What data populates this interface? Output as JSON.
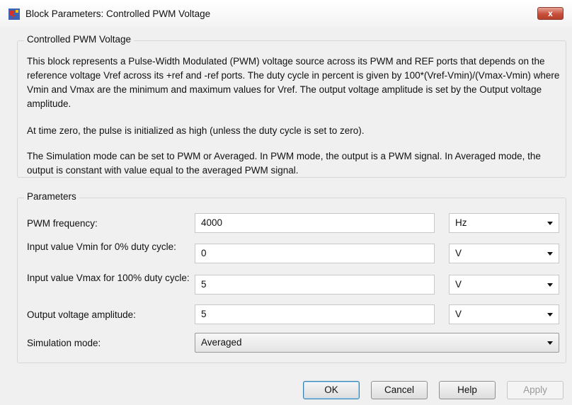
{
  "window": {
    "title": "Block Parameters: Controlled PWM Voltage",
    "close_symbol": "x"
  },
  "description_group": {
    "legend": "Controlled PWM Voltage",
    "paragraphs": [
      "This block represents a Pulse-Width Modulated (PWM) voltage source across its PWM and REF ports that depends on the reference voltage Vref across its +ref and -ref ports. The duty cycle in percent is given by 100*(Vref-Vmin)/(Vmax-Vmin) where Vmin and Vmax are the minimum and maximum values for Vref. The output voltage amplitude is set by the Output voltage amplitude.",
      "At time zero, the pulse is initialized as high (unless the duty cycle is set to zero).",
      "The Simulation mode can be set to PWM or Averaged. In PWM mode, the output is a PWM signal. In Averaged mode, the output is constant with value equal to the averaged PWM signal."
    ]
  },
  "parameters_group": {
    "legend": "Parameters",
    "pwm_frequency": {
      "label": "PWM frequency:",
      "value": "4000",
      "unit": "Hz"
    },
    "vmin": {
      "label": "Input value Vmin for 0% duty cycle:",
      "value": "0",
      "unit": "V"
    },
    "vmax": {
      "label": "Input value Vmax for 100% duty cycle:",
      "value": "5",
      "unit": "V"
    },
    "amplitude": {
      "label": "Output voltage amplitude:",
      "value": "5",
      "unit": "V"
    },
    "simulation_mode": {
      "label": "Simulation mode:",
      "value": "Averaged"
    }
  },
  "buttons": {
    "ok": "OK",
    "cancel": "Cancel",
    "help": "Help",
    "apply": "Apply"
  }
}
